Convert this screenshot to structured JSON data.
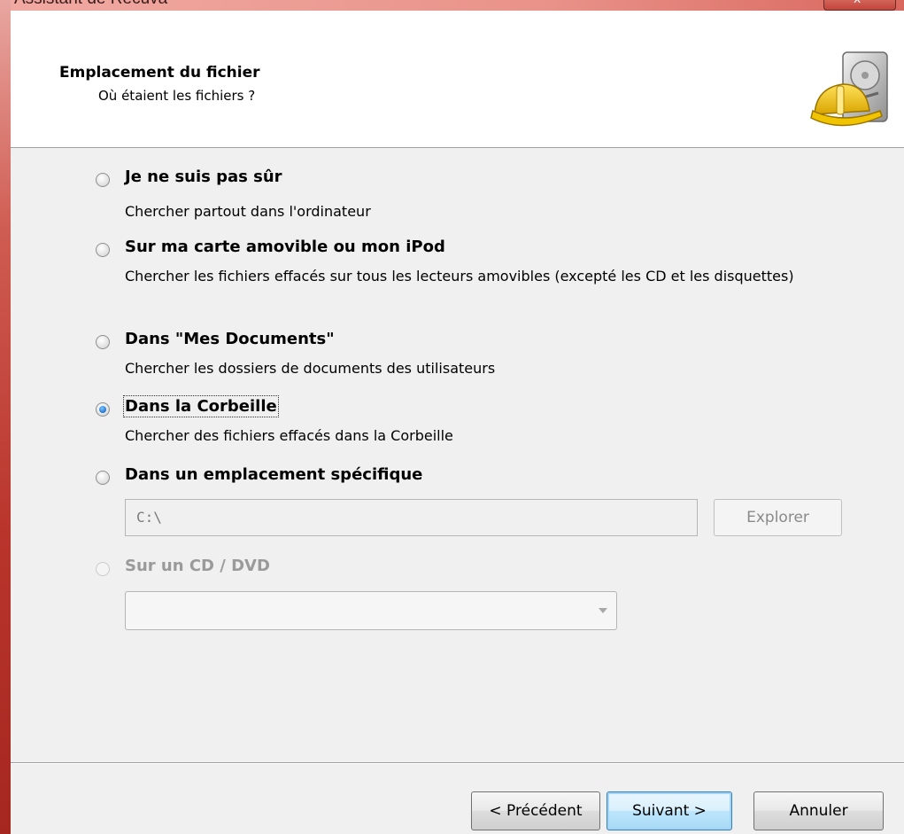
{
  "window": {
    "title": "Assistant de Recuva",
    "close_glyph": "x"
  },
  "header": {
    "title": "Emplacement du fichier",
    "subtitle": "Où étaient les fichiers ?",
    "logo_icon": "recuva-hard-hat-disk-icon"
  },
  "options": [
    {
      "label": "Je ne suis pas sûr",
      "description": "Chercher partout dans l'ordinateur",
      "checked": false,
      "enabled": true
    },
    {
      "label": "Sur ma carte amovible ou mon iPod",
      "description": "Chercher les fichiers effacés sur tous les lecteurs amovibles (excepté les CD et les disquettes)",
      "checked": false,
      "enabled": true
    },
    {
      "label": "Dans \"Mes Documents\"",
      "description": "Chercher les dossiers de documents des utilisateurs",
      "checked": false,
      "enabled": true
    },
    {
      "label": "Dans la Corbeille",
      "description": "Chercher des fichiers effacés dans la Corbeille",
      "checked": true,
      "enabled": true
    },
    {
      "label": "Dans un emplacement spécifique",
      "description": "",
      "checked": false,
      "enabled": true
    },
    {
      "label": "Sur un CD / DVD",
      "description": "",
      "checked": false,
      "enabled": false
    }
  ],
  "location": {
    "path_value": "C:\\",
    "browse_label": "Explorer"
  },
  "cd": {
    "selected": ""
  },
  "footer": {
    "back_label": "< Précédent",
    "next_label": "Suivant >",
    "cancel_label": "Annuler"
  },
  "colors": {
    "titlebar": "#e9938a",
    "frame": "#b9352c",
    "accent_radio": "#2a7fd4",
    "default_button_border": "#3c7fb1"
  }
}
